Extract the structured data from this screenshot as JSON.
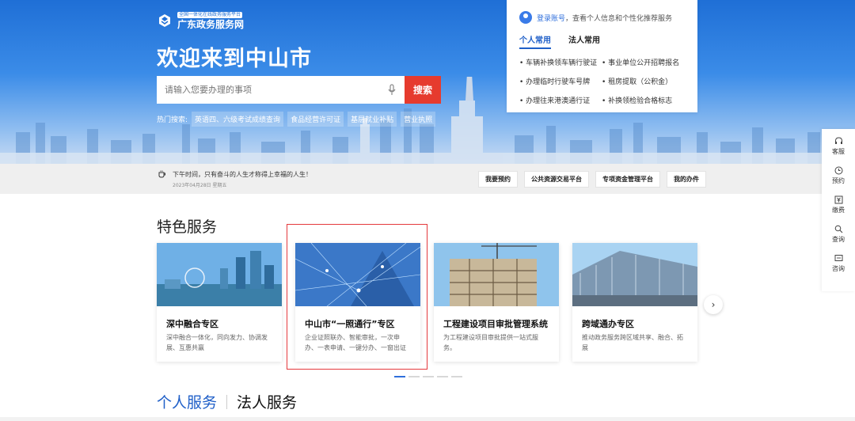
{
  "header": {
    "logo_tagline": "全国一体化在线政务服务平台",
    "logo_name": "广东政务服务网",
    "welcome": "欢迎来到中山市"
  },
  "search": {
    "placeholder": "请输入您要办理的事项",
    "button": "搜索"
  },
  "hot": {
    "label": "热门搜索:",
    "tags": [
      "英语四、六级考试成绩查询",
      "食品经营许可证",
      "基层就业补贴",
      "营业执照"
    ]
  },
  "login_card": {
    "login_link": "登录账号",
    "login_rest": "，查看个人信息和个性化推荐服务",
    "tabs": [
      "个人常用",
      "法人常用"
    ],
    "quick": [
      "车辆补换领车辆行驶证",
      "事业单位公开招聘报名",
      "办理临时行驶车号牌",
      "租房提取（公积金）",
      "办理往来港澳通行证",
      "补换领检验合格标志"
    ]
  },
  "notice": {
    "text": "下午时间，只有奋斗的人生才称得上幸福的人生！",
    "date": "2023年04月28日 星期五",
    "links": [
      "我要预约",
      "公共资源交易平台",
      "专项资金管理平台",
      "我的办件"
    ]
  },
  "sidebar": [
    "客服",
    "预约",
    "缴费",
    "查询",
    "咨询"
  ],
  "features": {
    "title": "特色服务",
    "cards": [
      {
        "title": "深中融合专区",
        "desc": "深中融合一体化，同向发力、协调发展、互惠共赢"
      },
      {
        "title": "中山市“一照通行”专区",
        "desc": "企业证照联办、智能审批，一次申办、一表申请、一键分办、一窗出证"
      },
      {
        "title": "工程建设项目审批管理系统",
        "desc": "为工程建设项目审批提供一站式服务。"
      },
      {
        "title": "跨域通办专区",
        "desc": "推动政务服务跨区域共享、融合、拓展"
      }
    ],
    "next_icon": "›"
  },
  "bottom_tabs": [
    "个人服务",
    "法人服务"
  ],
  "colors": {
    "brand_blue": "#1f6fd6",
    "search_red": "#e63b2e",
    "highlight_red": "#e4393c"
  }
}
